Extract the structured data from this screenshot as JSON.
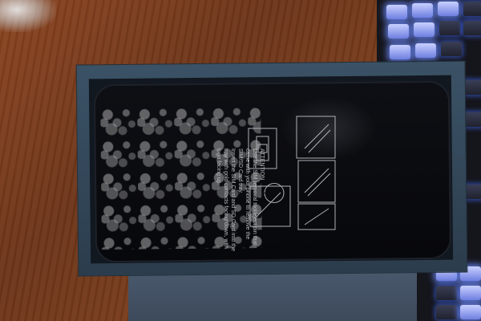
{
  "scene": {
    "description_items": [
      "wooden-table",
      "keyboard-with-blue-backlight",
      "phone-in-retail-box"
    ]
  },
  "film_text": {
    "heading": "ATTENTION",
    "line1": "Use the SIM removal tool/eject pin that",
    "line2": "came with your phone to remove the",
    "line3": "SIM/SD Card tray.",
    "line4": "Insert the SIM Card and SD Card into the",
    "line5": "tray with gold contacts facing down, with",
    "line6": "logo facing up."
  },
  "colors": {
    "wood": "#7a3d1c",
    "box": "#2b3d4d",
    "phone": "#07080b",
    "keyboard_glow": "#6f7fe0"
  }
}
